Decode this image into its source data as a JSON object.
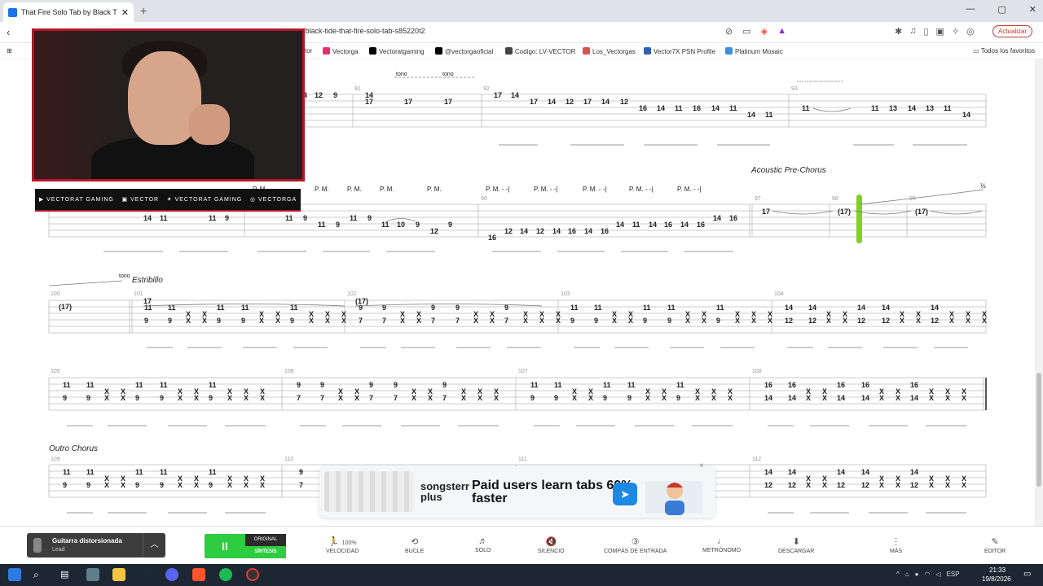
{
  "browser": {
    "tab_title": "That Fire Solo Tab by Black Tide",
    "new_tab": "+",
    "url": "/black-tide-that-fire-solo-tab-s85220t2",
    "update_button": "Actualizar",
    "window_controls": [
      "—",
      "▢",
      "✕"
    ],
    "bookmarks": [
      {
        "label": "ctor",
        "color": "#ffffff"
      },
      {
        "label": "Vectorga",
        "color": "#e1306c"
      },
      {
        "label": "Vectoratgaming",
        "color": "#000000"
      },
      {
        "label": "@vectorgaoficial",
        "color": "#000000"
      },
      {
        "label": "Codigo: LV-VECTOR",
        "color": "#444444"
      },
      {
        "label": "Los_Vectorgas",
        "color": "#d9534f"
      },
      {
        "label": "Vector7X PSN Profile",
        "color": "#2f5fb3"
      },
      {
        "label": "Platinum Mosaic",
        "color": "#3b8fd9"
      }
    ],
    "all_bookmarks": "Todos los favoritos"
  },
  "webcam": {
    "social_links": [
      "VECTORAT GAMING",
      "VECTOR",
      "VECTORAT GAMING",
      "VECTORGA"
    ]
  },
  "tab": {
    "row1": {
      "bar_numbers": [
        "91",
        "92",
        "93"
      ],
      "annotations": [
        "tono",
        "tono",
        "tono"
      ],
      "notes": [
        "4",
        "12",
        "9",
        "14",
        "17",
        "17",
        "17",
        "17",
        "14",
        "17",
        "14",
        "12",
        "17",
        "14",
        "12",
        "16",
        "14",
        "11",
        "16",
        "14",
        "11",
        "14",
        "11",
        "11",
        "11",
        "13",
        "14",
        "13",
        "11",
        "14"
      ]
    },
    "row2": {
      "section": "Acoustic Pre-Chorus",
      "bar_numbers": [
        "96",
        "97",
        "98",
        "99"
      ],
      "pm": [
        "P. M.",
        "P. M.",
        "P. M.",
        "P. M.",
        "P. M.",
        "P. M. - -|",
        "P. M. - -|",
        "P. M. - -|",
        "P. M. - -|",
        "P. M. - -|"
      ],
      "notes": [
        "14",
        "11",
        "11",
        "9",
        "11",
        "9",
        "11",
        "9",
        "11",
        "9",
        "11",
        "10",
        "9",
        "9",
        "12",
        "16",
        "12",
        "14",
        "12",
        "14",
        "16",
        "14",
        "16",
        "14",
        "11",
        "14",
        "16",
        "14",
        "16",
        "14",
        "16",
        "17",
        "(17)",
        "(17)"
      ],
      "half": "½"
    },
    "row3": {
      "section": "Estribillo",
      "bar_numbers": [
        "100",
        "101",
        "102",
        "103",
        "104"
      ],
      "tono": "tono",
      "held1": "(17)",
      "held2": "(17)",
      "held3": "(17)"
    },
    "row4": {
      "bar_numbers": [
        "105",
        "106",
        "107",
        "108"
      ]
    },
    "row5": {
      "section": "Outro Chorus",
      "bar_numbers": [
        "109",
        "110",
        "111",
        "112"
      ]
    }
  },
  "ad": {
    "brand": "songsterr plus",
    "headline": "Paid users learn tabs 60% faster",
    "close": "×"
  },
  "player": {
    "track_name": "Guitarra distorsionada",
    "track_sub": "Lead",
    "play_label": "II",
    "original": "ORIGINAL",
    "synthesis": "SÍNTESIS",
    "controls": [
      {
        "label": "VELOCIDAD",
        "value": "100%",
        "icon": "speed-icon"
      },
      {
        "label": "BUCLE",
        "value": "",
        "icon": "loop-icon"
      },
      {
        "label": "SOLO",
        "value": "",
        "icon": "headphones-icon"
      },
      {
        "label": "SILENCIO",
        "value": "",
        "icon": "mute-icon"
      },
      {
        "label": "COMPÁS DE ENTRADA",
        "value": "",
        "icon": "countin-icon"
      },
      {
        "label": "METRÓNOMO",
        "value": "",
        "icon": "metronome-icon"
      },
      {
        "label": "DESCARGAR",
        "value": "",
        "icon": "download-icon"
      },
      {
        "label": "MÁS",
        "value": "",
        "icon": "more-icon"
      },
      {
        "label": "EDITOR",
        "value": "",
        "icon": "edit-icon"
      }
    ]
  },
  "taskbar": {
    "lang": "ESP",
    "time": "21:33",
    "date": "19/8/2026"
  }
}
